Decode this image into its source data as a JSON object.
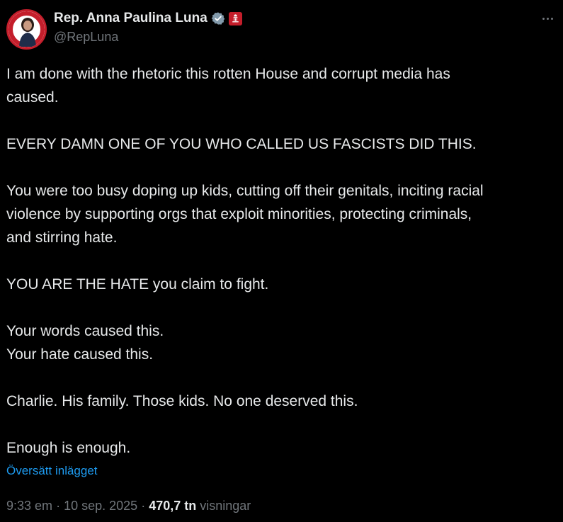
{
  "author": {
    "display_name": "Rep. Anna Paulina Luna",
    "handle": "@RepLuna",
    "avatar_icon": "congress-seal-avatar",
    "verified_icon": "verified-badge-icon",
    "affiliation_icon": "us-house-icon"
  },
  "tweet": {
    "lines": [
      "I am done with the rhetoric this rotten House and corrupt media has",
      "caused.",
      "",
      "EVERY DAMN ONE OF YOU WHO CALLED US FASCISTS DID THIS.",
      "",
      "You were too busy doping up kids, cutting off their genitals, inciting racial",
      "violence by supporting orgs that exploit minorities, protecting criminals,",
      "and stirring hate.",
      "",
      "YOU ARE THE HATE you claim to fight.",
      "",
      "Your words caused this.",
      "Your hate caused this.",
      "",
      "Charlie. His family. Those kids. No one deserved this.",
      "",
      "Enough is enough."
    ],
    "translate_label": "Översätt inlägget"
  },
  "meta": {
    "time": "9:33 em",
    "separator": "·",
    "date": "10 sep. 2025",
    "views_count": "470,7 tn",
    "views_label": "visningar"
  },
  "colors": {
    "background": "#000000",
    "text": "#e7e9ea",
    "secondary": "#71767b",
    "link": "#1d9bf0",
    "verified": "#829aab",
    "affiliation": "#c41e2b"
  }
}
